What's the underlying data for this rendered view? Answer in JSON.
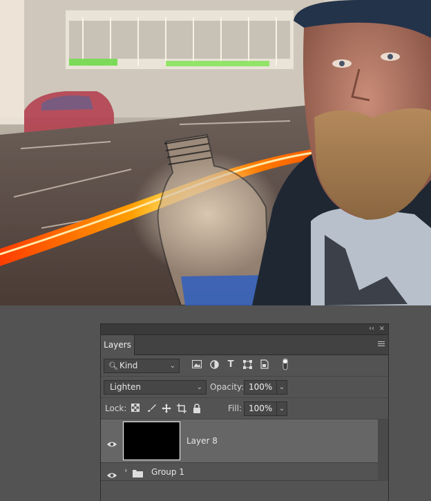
{
  "panel": {
    "tab_label": "Layers",
    "collapse_glyph": "‹‹",
    "close_glyph": "×"
  },
  "filter": {
    "kind_label": "Kind",
    "icons": [
      "image-filter-icon",
      "adjustment-filter-icon",
      "type-filter-icon",
      "shape-filter-icon",
      "smart-object-filter-icon",
      "filter-toggle-icon"
    ]
  },
  "blend": {
    "mode": "Lighten",
    "opacity_label": "Opacity:",
    "opacity_value": "100%"
  },
  "lock": {
    "label": "Lock:",
    "icons": [
      "lock-transparent-pixels-icon",
      "lock-image-pixels-icon",
      "lock-position-icon",
      "lock-artboard-icon",
      "lock-all-icon"
    ],
    "fill_label": "Fill:",
    "fill_value": "100%"
  },
  "layers": [
    {
      "name": "Layer 8",
      "visible": true,
      "selected": true,
      "type": "pixel"
    },
    {
      "name": "Group 1",
      "visible": true,
      "selected": false,
      "type": "group"
    }
  ],
  "colors": {
    "app_bg": "#535353",
    "panel_header": "#424242",
    "selected_row": "#666666",
    "field_bg": "#464646"
  }
}
